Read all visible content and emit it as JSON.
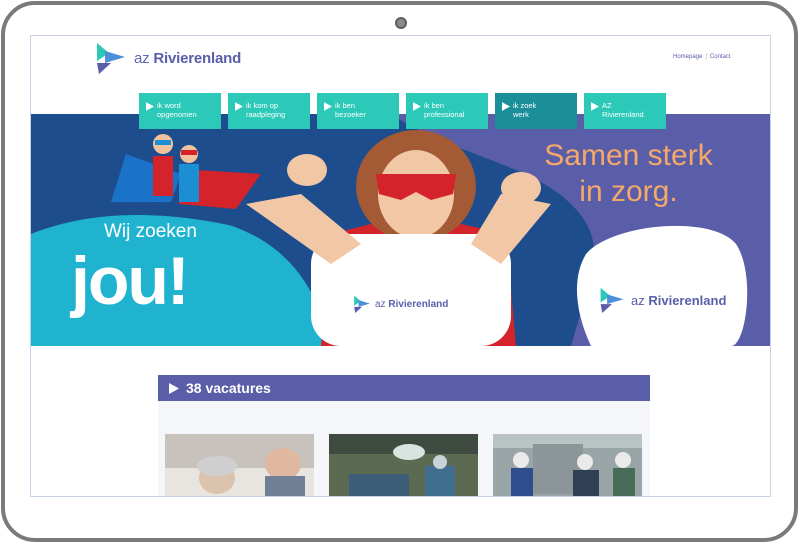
{
  "header": {
    "logo_prefix": "az",
    "logo_name": "Rivierenland",
    "links": [
      "Homepage",
      "Contact"
    ]
  },
  "nav": [
    {
      "line1": "ik word",
      "line2": "opgenomen",
      "active": false
    },
    {
      "line1": "ik kom op",
      "line2": "raadpleging",
      "active": false
    },
    {
      "line1": "ik ben",
      "line2": "bezoeker",
      "active": false
    },
    {
      "line1": "ik ben",
      "line2": "professional",
      "active": false
    },
    {
      "line1": "ik zoek",
      "line2": "werk",
      "active": true
    },
    {
      "line1": "AZ",
      "line2": "Rivierenland",
      "active": false
    }
  ],
  "hero": {
    "small_text": "Wij zoeken",
    "big_text": "jou!",
    "slogan_line1": "Samen sterk",
    "slogan_line2": "in zorg.",
    "logo_prefix": "az",
    "logo_name": "Rivierenland"
  },
  "vacancies": {
    "count_label": "38 vacatures"
  },
  "colors": {
    "brand_purple": "#5a5ea8",
    "teal": "#2cc9b8",
    "active_nav": "#1a8f9a",
    "slogan_orange": "#f4a86a",
    "hero_blue": "#1d4d8c"
  }
}
